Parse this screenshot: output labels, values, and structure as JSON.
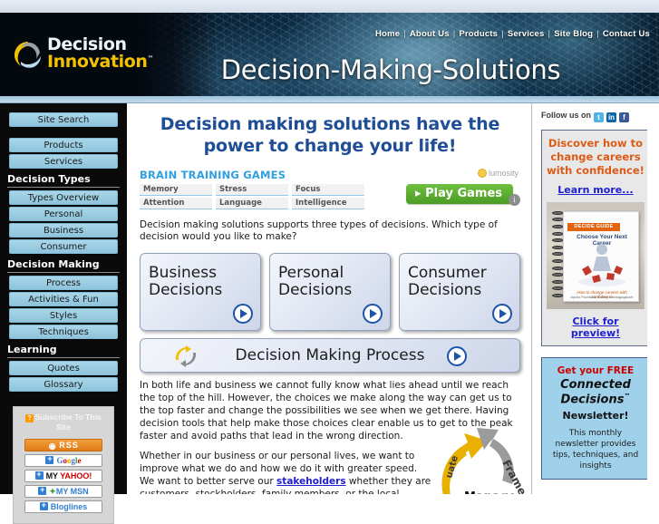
{
  "site": {
    "logo_line1": "Decision",
    "logo_line2": "Innovation",
    "logo_tm": "™",
    "banner_title": "Decision-Making-Solutions"
  },
  "topnav": {
    "items": [
      {
        "label": "Home"
      },
      {
        "label": "About Us"
      },
      {
        "label": "Products"
      },
      {
        "label": "Services"
      },
      {
        "label": "Site Blog"
      },
      {
        "label": "Contact Us"
      }
    ],
    "separator": "|"
  },
  "sidebar": {
    "buttons_top": [
      {
        "label": "Site Search",
        "name": "sidebar-item-site-search"
      }
    ],
    "buttons_mid": [
      {
        "label": "Products",
        "name": "sidebar-item-products"
      },
      {
        "label": "Services",
        "name": "sidebar-item-services"
      }
    ],
    "sections": [
      {
        "heading": "Decision Types",
        "items": [
          {
            "label": "Types Overview",
            "name": "sidebar-item-types-overview"
          },
          {
            "label": "Personal",
            "name": "sidebar-item-personal"
          },
          {
            "label": "Business",
            "name": "sidebar-item-business"
          },
          {
            "label": "Consumer",
            "name": "sidebar-item-consumer"
          }
        ]
      },
      {
        "heading": "Decision Making",
        "items": [
          {
            "label": "Process",
            "name": "sidebar-item-process"
          },
          {
            "label": "Activities & Fun",
            "name": "sidebar-item-activities-fun"
          },
          {
            "label": "Styles",
            "name": "sidebar-item-styles"
          },
          {
            "label": "Techniques",
            "name": "sidebar-item-techniques"
          }
        ]
      },
      {
        "heading": "Learning",
        "items": [
          {
            "label": "Quotes",
            "name": "sidebar-item-quotes"
          },
          {
            "label": "Glossary",
            "name": "sidebar-item-glossary"
          }
        ]
      }
    ],
    "subscribe": {
      "title": "Subscribe To This Site",
      "qmark": "?",
      "buttons": [
        {
          "label": "RSS",
          "name": "subscribe-rss-button"
        },
        {
          "label": "Google",
          "name": "subscribe-google-button"
        },
        {
          "label": "MY YAHOO!",
          "name": "subscribe-my-yahoo-button"
        },
        {
          "label": "MY MSN",
          "name": "subscribe-my-msn-button"
        },
        {
          "label": "Bloglines",
          "name": "subscribe-bloglines-button"
        }
      ]
    }
  },
  "main": {
    "headline": "Decision making solutions have the power to change your life!",
    "ad": {
      "title": "BRAIN TRAINING GAMES",
      "cells": [
        [
          "Memory",
          "Attention"
        ],
        [
          "Stress",
          "Language"
        ],
        [
          "Focus",
          "Intelligence"
        ]
      ],
      "brand": "lumosity",
      "cta": "▸ Play Games",
      "info": "i"
    },
    "intro_paragraph": "Decision making solutions supports three types of decisions. Which type of decision would you like to make?",
    "decision_boxes": [
      {
        "label": "Business\nDecisions",
        "name": "business-decisions-box"
      },
      {
        "label": "Personal\nDecisions",
        "name": "personal-decisions-box"
      },
      {
        "label": "Consumer\nDecisions",
        "name": "consumer-decisions-box"
      }
    ],
    "process_bar": {
      "label": "Decision Making Process",
      "name": "decision-making-process-bar"
    },
    "paragraph_1": "In both life and business we cannot fully know what lies ahead until we reach the top of the hill. However, the choices we make along the way can get us to the top faster and change the possibilities we see when we get there. Having decision tools that help make those choices clear enable us to get to the peak faster and avoid paths that lead in the wrong direction.",
    "paragraph_2_a": "Whether in our business or our personal lives, we want to improve what we do and how we do it with greater speed. We want to better serve our ",
    "paragraph_2_link": "stakeholders",
    "paragraph_2_b": " whether they are customers, stockholders, family members, or the local charity. We want to create value for our businesses, our families, and our",
    "wheel_labels": {
      "frame": "Frame",
      "manage": "Manage",
      "evaluate": "uate"
    }
  },
  "right": {
    "follow_label": "Follow us on",
    "social": [
      {
        "glyph": "t",
        "name": "twitter-icon"
      },
      {
        "glyph": "in",
        "name": "linkedin-icon"
      },
      {
        "glyph": "f",
        "name": "facebook-icon"
      }
    ],
    "promo": {
      "headline": "Discover how to change careers with confidence!",
      "learn_more": "Learn more...",
      "preview_link": "Click for preview!",
      "ebook_band": "DECIDE GUIDE",
      "ebook_title": "Choose Your Next Career",
      "ebook_sub": "How to change careers with confidence!",
      "ebook_authors": "Apollo Pachikara & Gary Gachagogaloch"
    },
    "newsletter": {
      "line1": "Get your FREE",
      "line2": "Connected Decisions",
      "tm": "™",
      "line3": "Newsletter!",
      "body": "This monthly newsletter provides tips, techniques, and insights"
    }
  },
  "colors": {
    "accent_blue": "#1f4e96",
    "nav_button": "#8ec4dc",
    "orange": "#dd5b17",
    "link": "#2020d0",
    "newsletter_bg": "#9fd2ea",
    "green_cta": "#4a9c24"
  }
}
